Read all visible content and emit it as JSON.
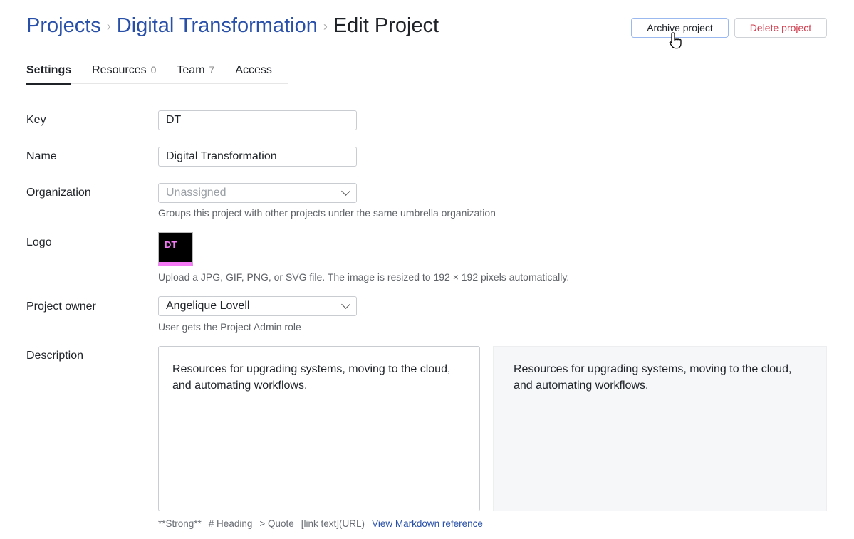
{
  "breadcrumb": {
    "items": [
      "Projects",
      "Digital Transformation"
    ],
    "current": "Edit Project"
  },
  "actions": {
    "archive": "Archive project",
    "delete": "Delete project"
  },
  "tabs": [
    {
      "label": "Settings",
      "count": null
    },
    {
      "label": "Resources",
      "count": "0"
    },
    {
      "label": "Team",
      "count": "7"
    },
    {
      "label": "Access",
      "count": null
    }
  ],
  "form": {
    "key": {
      "label": "Key",
      "value": "DT"
    },
    "name": {
      "label": "Name",
      "value": "Digital Transformation"
    },
    "organization": {
      "label": "Organization",
      "placeholder": "Unassigned",
      "help": "Groups this project with other projects under the same umbrella organization"
    },
    "logo": {
      "label": "Logo",
      "text": "DT",
      "help": "Upload a JPG, GIF, PNG, or SVG file. The image is resized to 192 × 192 pixels automatically."
    },
    "owner": {
      "label": "Project owner",
      "value": "Angelique Lovell",
      "help": "User gets the Project Admin role"
    },
    "description": {
      "label": "Description",
      "value": "Resources for upgrading systems, moving to the cloud, and automating workflows.",
      "preview": "Resources for upgrading systems, moving to the cloud, and automating workflows."
    }
  },
  "markdown_hints": [
    "**Strong**",
    "# Heading",
    "> Quote",
    "[link text](URL)"
  ],
  "markdown_link": "View Markdown reference",
  "colors": {
    "accent": "#2950a8",
    "danger": "#d0394a",
    "logo_bg": "#000000",
    "logo_accent": "#f57af5"
  }
}
